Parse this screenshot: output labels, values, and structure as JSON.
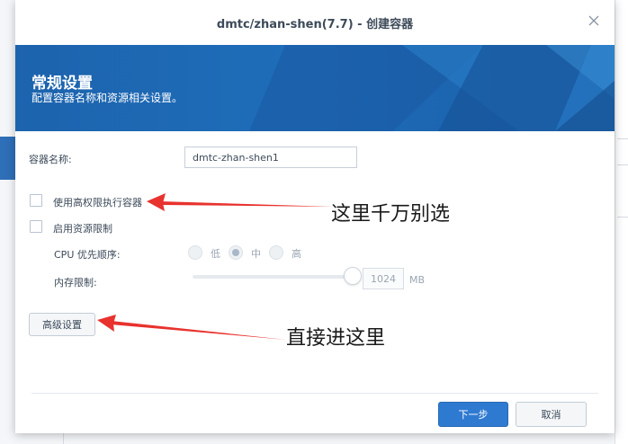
{
  "dialog": {
    "title": "dmtc/zhan-shen(7.7) - 创建容器"
  },
  "banner": {
    "title": "常规设置",
    "subtitle": "配置容器名称和资源相关设置。"
  },
  "form": {
    "container_name_label": "容器名称:",
    "container_name_value": "dmtc-zhan-shen1",
    "privileged_label": "使用高权限执行容器",
    "resource_limit_label": "启用资源限制",
    "cpu_priority_label": "CPU 优先顺序:",
    "cpu_options": [
      "低",
      "中",
      "高"
    ],
    "cpu_selected": "中",
    "memory_limit_label": "内存限制:",
    "memory_value": "1024",
    "memory_unit": "MB"
  },
  "buttons": {
    "advanced": "高级设置",
    "next": "下一步",
    "cancel": "取消"
  },
  "annotations": {
    "privileged_note": "这里千万别选",
    "advanced_note": "直接进这里",
    "arrow_color": "#e8322e"
  },
  "icons": {
    "close": "close-icon"
  },
  "colors": {
    "banner": "#1e6db9",
    "primary_button": "#2f7ad1"
  }
}
